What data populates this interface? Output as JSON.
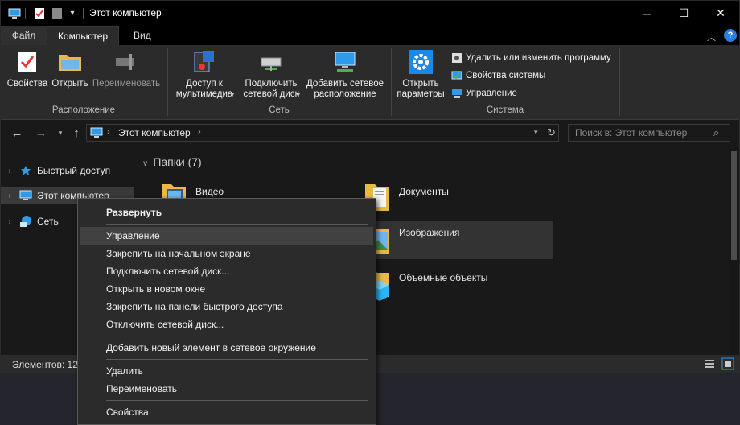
{
  "window": {
    "title": "Этот компьютер",
    "minimize_glyph": "─",
    "maximize_glyph": "☐",
    "close_glyph": "✕"
  },
  "ribbon_tabs": [
    {
      "label": "Файл"
    },
    {
      "label": "Компьютер"
    },
    {
      "label": "Вид"
    }
  ],
  "ribbon": {
    "location_group": {
      "label": "Расположение",
      "buttons": [
        {
          "label": "Свойства",
          "icon": "properties-icon"
        },
        {
          "label": "Открыть",
          "icon": "open-folder-icon"
        },
        {
          "label": "Переименовать",
          "icon": "rename-icon"
        }
      ]
    },
    "network_group": {
      "label": "Сеть",
      "buttons": [
        {
          "line1": "Доступ к",
          "line2": "мультимедиа",
          "icon": "media-access-icon"
        },
        {
          "line1": "Подключить",
          "line2": "сетевой диск",
          "icon": "map-network-drive-icon"
        },
        {
          "line1": "Добавить сетевое",
          "line2": "расположение",
          "icon": "add-network-location-icon"
        }
      ]
    },
    "system_group": {
      "label": "Система",
      "open_settings": {
        "line1": "Открыть",
        "line2": "параметры",
        "icon": "gear-icon"
      },
      "small_buttons": [
        {
          "label": "Удалить или изменить программу",
          "icon": "uninstall-program-icon"
        },
        {
          "label": "Свойства системы",
          "icon": "system-properties-icon"
        },
        {
          "label": "Управление",
          "icon": "manage-icon"
        }
      ]
    }
  },
  "address": {
    "path": "Этот компьютер",
    "search_placeholder": "Поиск в: Этот компьютер"
  },
  "nav_pane": [
    {
      "label": "Быстрый доступ",
      "icon": "star-icon"
    },
    {
      "label": "Этот компьютер",
      "icon": "computer-icon"
    },
    {
      "label": "Сеть",
      "icon": "network-icon"
    }
  ],
  "content": {
    "section_title": "Папки (7)",
    "folders": [
      {
        "label": "Видео",
        "icon": "video-folder-icon"
      },
      {
        "label": "Документы",
        "icon": "documents-folder-icon"
      },
      {
        "label": "Изображения",
        "icon": "pictures-folder-icon"
      },
      {
        "label": "Объемные объекты",
        "icon": "3d-objects-folder-icon"
      }
    ]
  },
  "status": {
    "items_text": "Элементов: 12"
  },
  "context_menu": {
    "items": [
      {
        "label": "Развернуть"
      },
      {
        "label": "Управление"
      },
      {
        "label": "Закрепить на начальном экране"
      },
      {
        "label": "Подключить сетевой диск..."
      },
      {
        "label": "Открыть в новом окне"
      },
      {
        "label": "Закрепить на панели быстрого доступа"
      },
      {
        "label": "Отключить сетевой диск..."
      },
      {
        "label": "Добавить новый элемент в сетевое окружение"
      },
      {
        "label": "Удалить"
      },
      {
        "label": "Переименовать"
      },
      {
        "label": "Свойства"
      }
    ]
  },
  "colors": {
    "accent_blue": "#1e88e5",
    "folder_yellow": "#e8b84a",
    "help_blue": "#2a7de1"
  }
}
